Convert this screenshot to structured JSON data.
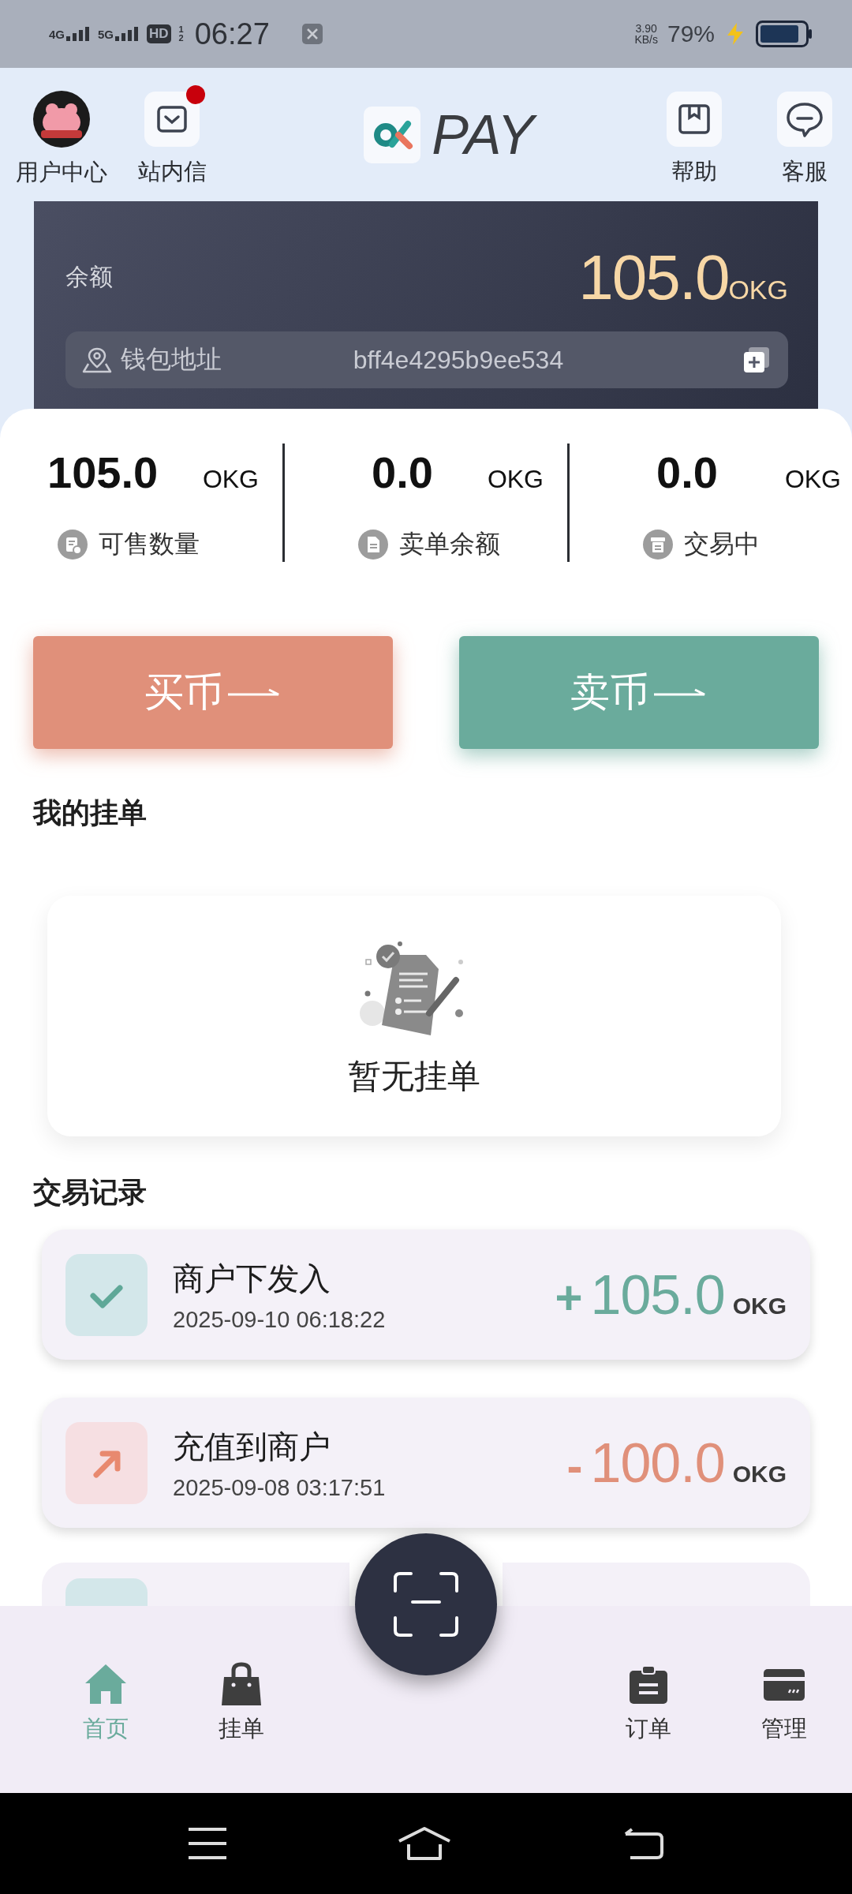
{
  "status_bar": {
    "network_1": "4G",
    "network_2": "5G",
    "hd": "HD",
    "hd_slots": [
      "1",
      "2"
    ],
    "time": "06:27",
    "speed": "3.90",
    "speed_unit": "KB/s",
    "battery": "79%"
  },
  "header": {
    "left": [
      {
        "label": "用户中心",
        "kind": "avatar",
        "unread": false
      },
      {
        "label": "站内信",
        "kind": "mail",
        "unread": true
      }
    ],
    "logo": "PAY",
    "right": [
      {
        "label": "帮助",
        "kind": "book",
        "unread": false
      },
      {
        "label": "客服",
        "kind": "chat",
        "unread": false
      }
    ]
  },
  "balance": {
    "label": "余额",
    "amount": "105.0",
    "unit": "OKG",
    "wallet_label": "钱包地址",
    "wallet_address": "bff4e4295b9ee534"
  },
  "stats": [
    {
      "value": "105.0",
      "unit": "OKG",
      "label": "可售数量",
      "kind": "sellable"
    },
    {
      "value": "0.0",
      "unit": "OKG",
      "label": "卖单余额",
      "kind": "sell_balance"
    },
    {
      "value": "0.0",
      "unit": "OKG",
      "label": "交易中",
      "kind": "trading"
    }
  ],
  "actions": [
    {
      "label": "买币",
      "kind": "buy"
    },
    {
      "label": "卖币",
      "kind": "sell"
    }
  ],
  "my_orders": {
    "title": "我的挂单",
    "empty_text": "暂无挂单"
  },
  "records": {
    "title": "交易记录",
    "items": [
      {
        "title": "商户下发入",
        "time": "2025-09-10 06:18:22",
        "sign": "+",
        "amount": "105.0",
        "unit": "OKG",
        "kind": "income"
      },
      {
        "title": "充值到商户",
        "time": "2025-09-08 03:17:51",
        "sign": "-",
        "amount": "100.0",
        "unit": "OKG",
        "kind": "expense"
      }
    ],
    "peek": {
      "kind": "income"
    }
  },
  "nav": [
    {
      "label": "首页",
      "kind": "home",
      "selected": true
    },
    {
      "label": "挂单",
      "kind": "bag",
      "selected": false
    },
    {
      "label": "订单",
      "kind": "clipboard",
      "selected": false
    },
    {
      "label": "管理",
      "kind": "card",
      "selected": false
    }
  ]
}
